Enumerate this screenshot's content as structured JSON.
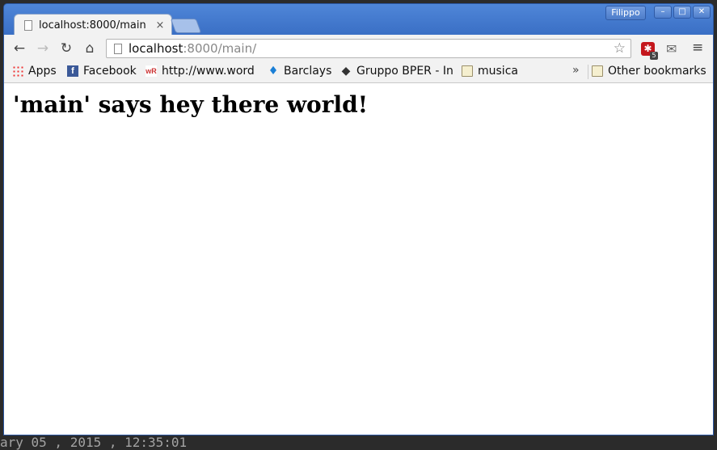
{
  "desktop": {
    "bottom_text": "ary 05 , 2015 , 12:35:01"
  },
  "window": {
    "profile_name": "Filippo",
    "controls": {
      "minimize": "–",
      "maximize": "□",
      "close": "✕"
    }
  },
  "tab": {
    "title": "localhost:8000/main",
    "close": "×"
  },
  "toolbar": {
    "back": "←",
    "forward": "→",
    "reload": "↻",
    "home": "⌂",
    "url_host": "localhost",
    "url_path": ":8000/main/",
    "star": "☆",
    "extension_badge": "5",
    "extension_glyph": "✱",
    "mail": "✉",
    "menu": "≡"
  },
  "bookmarks": {
    "items": [
      {
        "label": "Apps",
        "icon": "apps-grid-icon"
      },
      {
        "label": "Facebook",
        "icon": "facebook-icon"
      },
      {
        "label": "http://www.word",
        "icon": "wordreference-icon"
      },
      {
        "label": "Barclays",
        "icon": "barclays-eagle-icon"
      },
      {
        "label": "Gruppo BPER - Int",
        "icon": "bper-diamond-icon"
      },
      {
        "label": "musica",
        "icon": "folder-icon"
      }
    ],
    "overflow": "»",
    "other": "Other bookmarks"
  },
  "page": {
    "heading": "'main' says hey there world!"
  }
}
